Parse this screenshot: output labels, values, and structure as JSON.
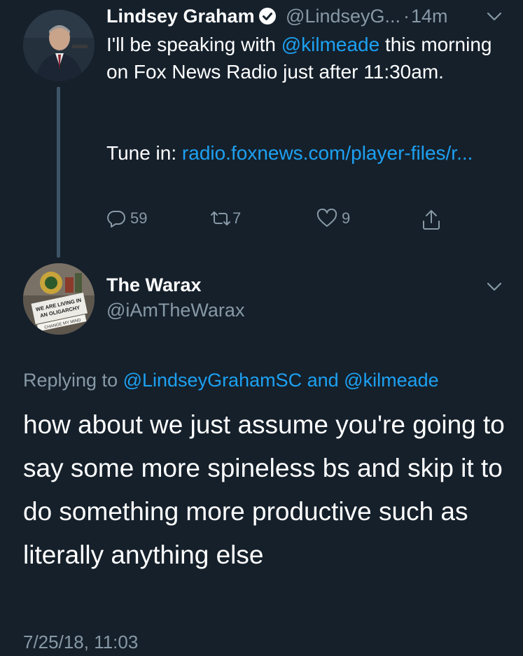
{
  "tweet": {
    "author_name": "Lindsey Graham",
    "author_handle": "@LindseyG...",
    "separator": "·",
    "time_ago": "14m",
    "text_line1_pre": "I'll be speaking with ",
    "text_mention": "@kilmeade",
    "text_line1_post": " this morning on Fox News Radio just after 11:30am.",
    "tune_in_label": "Tune in: ",
    "link_text": "radio.foxnews.com/player-files/r...",
    "reply_count": "59",
    "retweet_count": "7",
    "like_count": "9"
  },
  "reply": {
    "author_name": "The Warax",
    "author_handle": "@iAmTheWarax",
    "replying_prefix": "Replying to ",
    "replying_mention1": "@LindseyGrahamSC",
    "replying_and": " and ",
    "replying_mention2": "@kilmeade",
    "text": "how about we just assume you're going to say some more spineless bs and skip it to do something more productive such as literally anything else",
    "timestamp": "7/25/18, 11:03"
  },
  "avatar_signs": {
    "line1": "WE ARE LIVING IN",
    "line2": "AN OLIGARCHY",
    "line3": "CHANGE MY MIND"
  },
  "colors": {
    "background": "#15202b",
    "accent": "#1da1f2",
    "secondary_text": "#8899a6",
    "thread_line": "#3d5466"
  }
}
